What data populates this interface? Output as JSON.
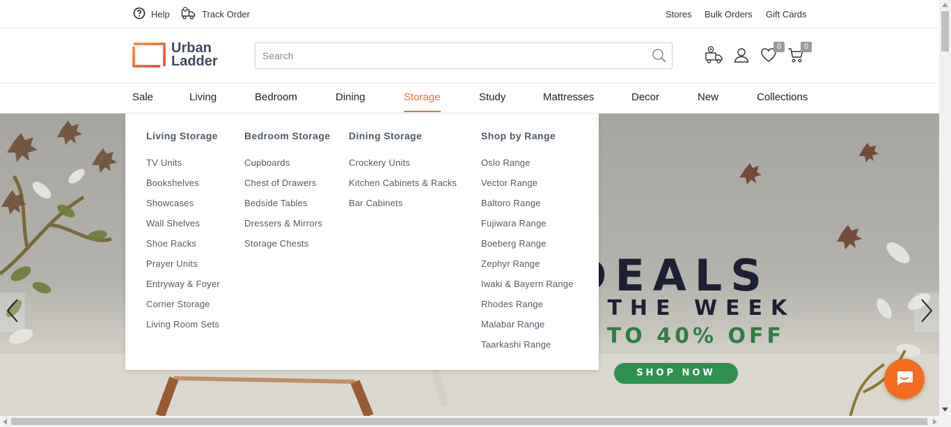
{
  "topbar": {
    "help": "Help",
    "track_order": "Track Order",
    "stores": "Stores",
    "bulk_orders": "Bulk Orders",
    "gift_cards": "Gift Cards"
  },
  "header": {
    "logo_line1": "Urban",
    "logo_line2": "Ladder",
    "search_placeholder": "Search",
    "wishlist_count": "0",
    "cart_count": "0"
  },
  "nav": {
    "items": [
      "Sale",
      "Living",
      "Bedroom",
      "Dining",
      "Storage",
      "Study",
      "Mattresses",
      "Decor",
      "New",
      "Collections"
    ],
    "active": "Storage"
  },
  "mega_menu": {
    "columns": [
      {
        "title": "Living Storage",
        "items": [
          "TV Units",
          "Bookshelves",
          "Showcases",
          "Wall Shelves",
          "Shoe Racks",
          "Prayer Units",
          "Entryway & Foyer",
          "Corner Storage",
          "Living Room Sets"
        ]
      },
      {
        "title": "Bedroom Storage",
        "items": [
          "Cupboards",
          "Chest of Drawers",
          "Bedside Tables",
          "Dressers & Mirrors",
          "Storage Chests"
        ]
      },
      {
        "title": "Dining Storage",
        "items": [
          "Crockery Units",
          "Kitchen Cabinets & Racks",
          "Bar Cabinets"
        ]
      },
      {
        "title": "Shop by Range",
        "items": [
          "Oslo Range",
          "Vector Range",
          "Baltoro Range",
          "Fujiwara Range",
          "Boeberg Range",
          "Zephyr Range",
          "Iwaki & Bayern Range",
          "Rhodes Range",
          "Malabar Range",
          "Taarkashi Range"
        ]
      }
    ]
  },
  "banner": {
    "headline": "DEALS",
    "line2_visible": "THE WEEK",
    "line3_visible": "TO 40% OFF",
    "cta": "SHOP NOW"
  },
  "colors": {
    "accent": "#f26d35",
    "brand_text": "#3c4a5d",
    "menu_text": "#4f5b67",
    "cta_green": "#2f9150",
    "chat_orange": "#f26d20"
  },
  "icons": [
    "help-icon",
    "truck-icon",
    "logo-mark",
    "search-icon",
    "store-locator-icon",
    "user-icon",
    "heart-icon",
    "cart-icon",
    "chevron-left-icon",
    "chevron-right-icon",
    "chat-icon"
  ]
}
